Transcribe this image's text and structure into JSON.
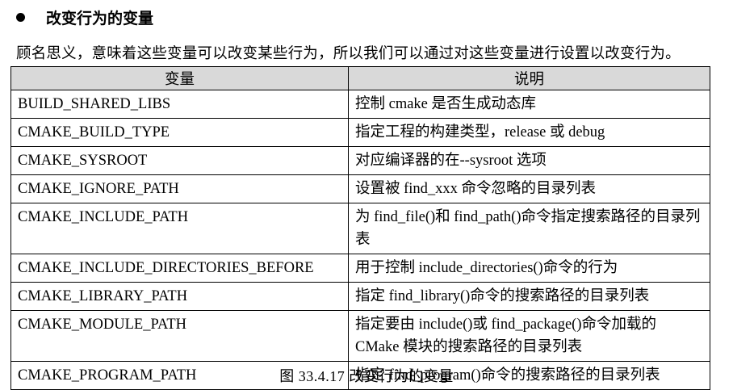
{
  "heading": "改变行为的变量",
  "intro": "顾名思义，意味着这些变量可以改变某些行为，所以我们可以通过对这些变量进行设置以改变行为。",
  "table": {
    "headers": [
      "变量",
      "说明"
    ],
    "rows": [
      {
        "name": "BUILD_SHARED_LIBS",
        "desc": "控制 cmake 是否生成动态库"
      },
      {
        "name": "CMAKE_BUILD_TYPE",
        "desc": "指定工程的构建类型，release 或 debug"
      },
      {
        "name": "CMAKE_SYSROOT",
        "desc": "对应编译器的在--sysroot 选项"
      },
      {
        "name": "CMAKE_IGNORE_PATH",
        "desc": "设置被 find_xxx 命令忽略的目录列表"
      },
      {
        "name": "CMAKE_INCLUDE_PATH",
        "desc": "为 find_file()和 find_path()命令指定搜索路径的目录列表"
      },
      {
        "name": "CMAKE_INCLUDE_DIRECTORIES_BEFORE",
        "desc": "用于控制 include_directories()命令的行为"
      },
      {
        "name": "CMAKE_LIBRARY_PATH",
        "desc": "指定 find_library()命令的搜索路径的目录列表"
      },
      {
        "name": "CMAKE_MODULE_PATH",
        "desc": "指定要由 include()或 find_package()命令加载的 CMake 模块的搜索路径的目录列表"
      },
      {
        "name": "CMAKE_PROGRAM_PATH",
        "desc": "指定 find_program()命令的搜索路径的目录列表"
      }
    ]
  },
  "caption": "图 33.4.17 改变行为的变量"
}
